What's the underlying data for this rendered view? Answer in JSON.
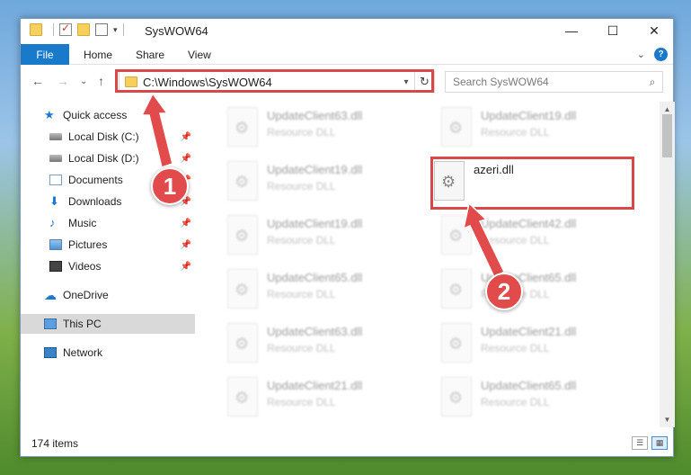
{
  "window": {
    "title": "SysWOW64",
    "controls": {
      "minimize": "—",
      "maximize": "☐",
      "close": "✕"
    }
  },
  "ribbon": {
    "tabs": [
      "File",
      "Home",
      "Share",
      "View"
    ],
    "collapse": "⌄",
    "help": "?"
  },
  "nav": {
    "back": "←",
    "forward": "→",
    "recent": "⌄",
    "up": "↑",
    "address": "C:\\Windows\\SysWOW64",
    "refresh": "↻",
    "search_placeholder": "Search SysWOW64"
  },
  "sidebar": {
    "items": [
      {
        "label": "Quick access",
        "icon": "star-icon"
      },
      {
        "label": "Local Disk (C:)",
        "icon": "disk-icon",
        "pinned": true
      },
      {
        "label": "Local Disk (D:)",
        "icon": "disk-icon",
        "pinned": true
      },
      {
        "label": "Documents",
        "icon": "documents-icon",
        "pinned": true
      },
      {
        "label": "Downloads",
        "icon": "download-icon",
        "pinned": true
      },
      {
        "label": "Music",
        "icon": "music-icon",
        "pinned": true
      },
      {
        "label": "Pictures",
        "icon": "pictures-icon",
        "pinned": true
      },
      {
        "label": "Videos",
        "icon": "videos-icon",
        "pinned": true
      },
      {
        "label": "OneDrive",
        "icon": "cloud-icon"
      },
      {
        "label": "This PC",
        "icon": "computer-icon",
        "selected": true
      },
      {
        "label": "Network",
        "icon": "network-icon"
      }
    ]
  },
  "files": {
    "left": [
      {
        "name": "UpdateClient63.dll",
        "type": "Resource DLL"
      },
      {
        "name": "UpdateClient19.dll",
        "type": "Resource DLL"
      },
      {
        "name": "UpdateClient19.dll",
        "type": "Resource DLL"
      },
      {
        "name": "UpdateClient65.dll",
        "type": "Resource DLL"
      },
      {
        "name": "UpdateClient63.dll",
        "type": "Resource DLL"
      },
      {
        "name": "UpdateClient21.dll",
        "type": "Resource DLL"
      }
    ],
    "right": [
      {
        "name": "UpdateClient19.dll",
        "type": "Resource DLL"
      },
      {
        "name": "azeri.dll",
        "type": ""
      },
      {
        "name": "UpdateClient42.dll",
        "type": "Resource DLL"
      },
      {
        "name": "UpdateClient65.dll",
        "type": "Resource DLL"
      },
      {
        "name": "UpdateClient21.dll",
        "type": "Resource DLL"
      },
      {
        "name": "UpdateClient65.dll",
        "type": "Resource DLL"
      }
    ]
  },
  "status": {
    "item_count": "174 items"
  },
  "annotations": {
    "marker1": "1",
    "marker2": "2",
    "color": "#e24b4b"
  }
}
